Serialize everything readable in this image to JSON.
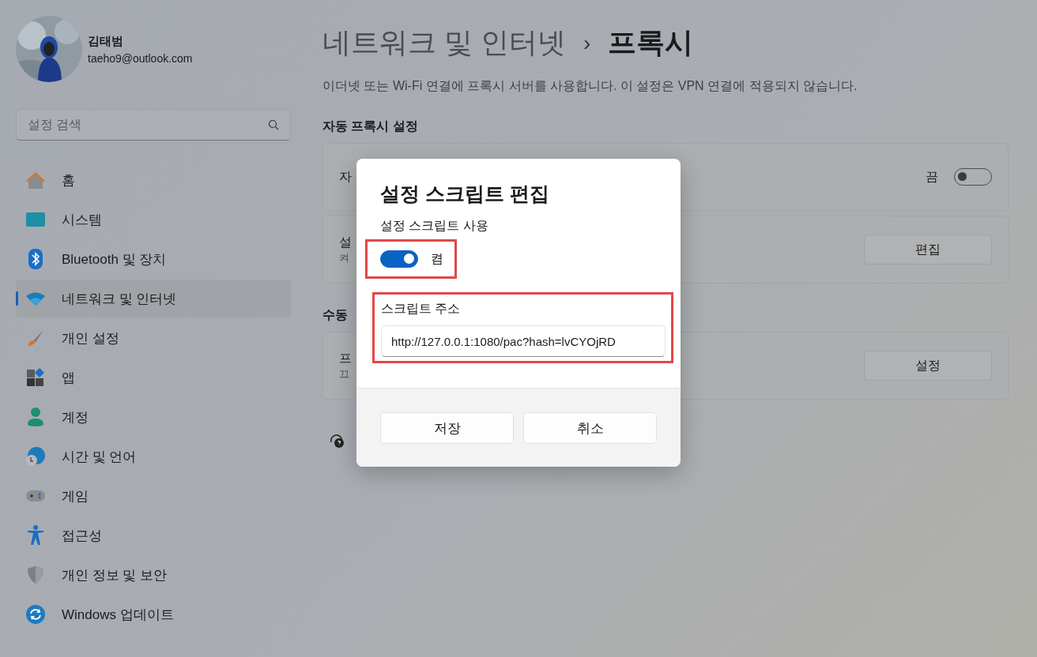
{
  "user": {
    "name": "김태범",
    "email": "taeho9@outlook.com"
  },
  "search": {
    "placeholder": "설정 검색"
  },
  "sidebar": {
    "items": [
      {
        "label": "홈",
        "selected": false
      },
      {
        "label": "시스템",
        "selected": false
      },
      {
        "label": "Bluetooth 및 장치",
        "selected": false
      },
      {
        "label": "네트워크 및 인터넷",
        "selected": true
      },
      {
        "label": "개인 설정",
        "selected": false
      },
      {
        "label": "앱",
        "selected": false
      },
      {
        "label": "계정",
        "selected": false
      },
      {
        "label": "시간 및 언어",
        "selected": false
      },
      {
        "label": "게임",
        "selected": false
      },
      {
        "label": "접근성",
        "selected": false
      },
      {
        "label": "개인 정보 및 보안",
        "selected": false
      },
      {
        "label": "Windows 업데이트",
        "selected": false
      }
    ]
  },
  "breadcrumb": {
    "parent": "네트워크 및 인터넷",
    "separator": "›",
    "current": "프록시"
  },
  "description": "이더넷 또는 Wi-Fi 연결에 프록시 서버를 사용합니다. 이 설정은 VPN 연결에 적용되지 않습니다.",
  "sections": [
    {
      "heading": "자동 프록시 설정",
      "cards": [
        {
          "kind": "toggle",
          "title": "자",
          "state_label": "끔",
          "on": false
        },
        {
          "kind": "button",
          "title": "설",
          "subtitle": "켜",
          "button": "편집"
        }
      ]
    },
    {
      "heading": "수동",
      "cards": [
        {
          "kind": "button",
          "title": "프",
          "subtitle": "끄",
          "button": "설정"
        }
      ]
    }
  ],
  "dialog": {
    "title": "설정 스크립트 편집",
    "toggle_label": "설정 스크립트 사용",
    "toggle": {
      "on": true,
      "state_label": "켬"
    },
    "address_label": "스크립트 주소",
    "address_value": "http://127.0.0.1:1080/pac?hash=lvCYOjRD",
    "buttons": [
      "저장",
      "취소"
    ]
  }
}
